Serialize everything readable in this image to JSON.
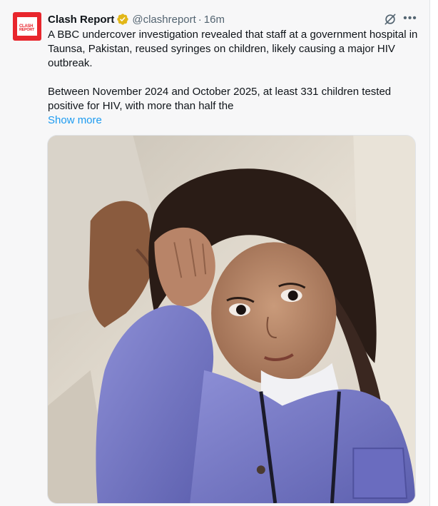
{
  "tweet": {
    "author_name": "Clash Report",
    "avatar_text_line1": "CLASH",
    "avatar_text_line2": "REPORT",
    "handle": "@clashreport",
    "separator": "·",
    "time": "16m",
    "verified": true,
    "paragraph1": "A BBC undercover investigation revealed that staff at a government hospital in Taunsa, Pakistan, reused syringes on children, likely causing a major HIV outbreak.",
    "paragraph2": "Between November 2024 and October 2025, at least 331 children tested positive for HIV, with more than half the",
    "show_more_label": "Show more",
    "icons": {
      "verified": "verified-badge-icon",
      "grok": "grok-icon",
      "more": "more-options-icon"
    },
    "colors": {
      "avatar_red": "#e8262d",
      "verified_gold": "#e2b719",
      "link_blue": "#1d9bf0",
      "muted_text": "#536471"
    }
  },
  "media": {
    "icon": "photo-of-child-with-adult-hand"
  }
}
